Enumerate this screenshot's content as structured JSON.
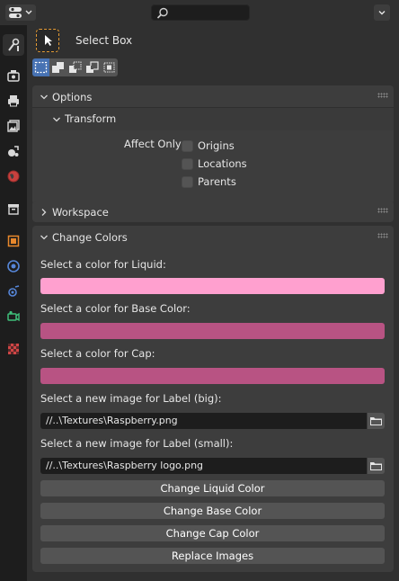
{
  "header": {
    "editor_type_icon": "properties-editor-icon",
    "search": {
      "placeholder": "",
      "value": ""
    }
  },
  "sidebar": {
    "tabs": [
      {
        "name": "tool",
        "icon": "wrench-screwdriver-icon",
        "active": true
      },
      {
        "name": "render",
        "icon": "camera-back-icon"
      },
      {
        "name": "output",
        "icon": "printer-icon"
      },
      {
        "name": "view-layer",
        "icon": "images-icon"
      },
      {
        "name": "scene",
        "icon": "scene-icon"
      },
      {
        "name": "world",
        "icon": "globe-icon"
      },
      {
        "name": "collection",
        "icon": "collection-box-icon"
      },
      {
        "name": "object",
        "icon": "orange-square-icon"
      },
      {
        "name": "modifiers",
        "icon": "blue-circle-icon"
      },
      {
        "name": "physics",
        "icon": "blue-orbit-icon"
      },
      {
        "name": "object-data",
        "icon": "green-camera-icon"
      },
      {
        "name": "texture",
        "icon": "checker-icon"
      }
    ]
  },
  "tool": {
    "name": "Select Box"
  },
  "options_panel": {
    "title": "Options",
    "transform": {
      "title": "Transform",
      "affect_only_label": "Affect Only",
      "checkboxes": [
        {
          "label": "Origins",
          "checked": false
        },
        {
          "label": "Locations",
          "checked": false
        },
        {
          "label": "Parents",
          "checked": false
        }
      ]
    }
  },
  "workspace_panel": {
    "title": "Workspace"
  },
  "change_colors_panel": {
    "title": "Change Colors",
    "liquid_label": "Select a color for Liquid:",
    "liquid_color": "#ffa0cf",
    "base_label": "Select a color for Base Color:",
    "base_color": "#b85383",
    "cap_label": "Select a color for Cap:",
    "cap_color": "#b85383",
    "label_big_label": "Select a new image for Label (big):",
    "label_big_path": "//..\\Textures\\Raspberry.png",
    "label_small_label": "Select a new image for Label (small):",
    "label_small_path": "//..\\Textures\\Raspberry logo.png",
    "buttons": {
      "liquid": "Change Liquid Color",
      "base": "Change Base Color",
      "cap": "Change Cap Color",
      "images": "Replace Images"
    }
  },
  "colors": {
    "accent_blue": "#4772b3",
    "tool_outline": "#e59b34"
  }
}
